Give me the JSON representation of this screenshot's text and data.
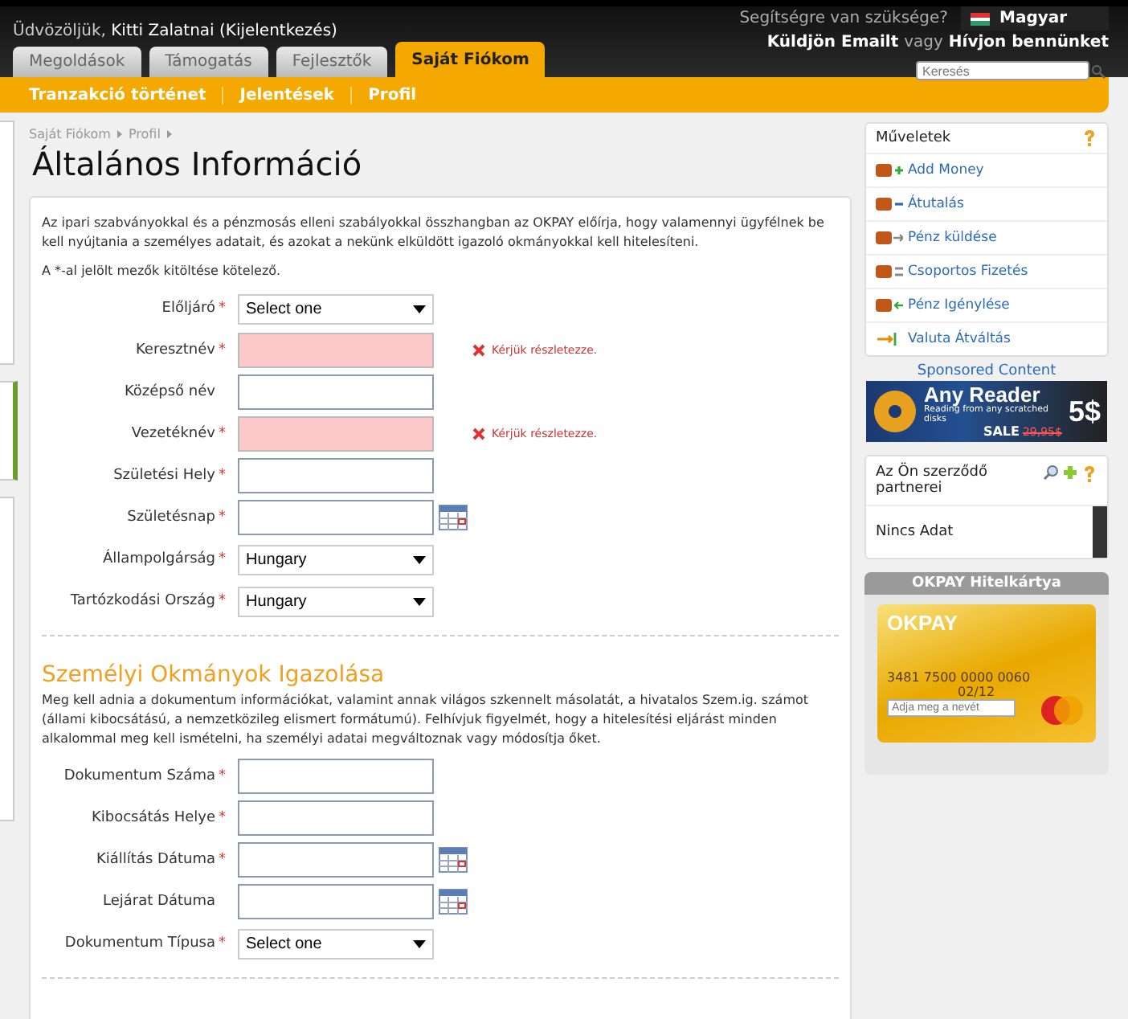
{
  "header": {
    "greeting": "Üdvözöljük,",
    "user": "Kitti Zalatnai (Kijelentkezés)",
    "help": "Segítségre van szüksége?",
    "contact_email": "Küldjön Emailt",
    "contact_or": "vagy",
    "contact_call": "Hívjon bennünket",
    "language": "Magyar",
    "search": {
      "placeholder": "Keresés"
    }
  },
  "tabs": [
    {
      "label": "Megoldások",
      "selected": false
    },
    {
      "label": "Támogatás",
      "selected": false
    },
    {
      "label": "Fejlesztők",
      "selected": false
    },
    {
      "label": "Saját Fiókom",
      "selected": true
    }
  ],
  "subnav": [
    "Tranzakció történet",
    "Jelentések",
    "Profil"
  ],
  "breadcrumb": [
    "Saját Fiókom",
    "Profil"
  ],
  "title": "Általános Információ",
  "intro": "Az ipari szabványokkal és a pénzmosás elleni szabályokkal összhangban az OKPAY előírja, hogy valamennyi ügyfélnek be kell nyújtania a személyes adatait, és azokat a nekünk elküldött igazoló okmányokkal kell hitelesíteni.",
  "required_note": "A *-al jelölt mezők kitöltése kötelező.",
  "required_mark": "*",
  "general_fields": [
    {
      "label": "Előljáró",
      "kind": "select",
      "required": true,
      "value": "Select one",
      "error": false
    },
    {
      "label": "Keresztnév",
      "kind": "text",
      "required": true,
      "error": true,
      "error_text": "Kérjük részletezze."
    },
    {
      "label": "Középső név",
      "kind": "text",
      "required": false,
      "error": false
    },
    {
      "label": "Vezetéknév",
      "kind": "text",
      "required": true,
      "error": true,
      "error_text": "Kérjük részletezze."
    },
    {
      "label": "Születési Hely",
      "kind": "text",
      "required": true,
      "error": false
    },
    {
      "label": "Születésnap",
      "kind": "date",
      "required": true,
      "error": false
    },
    {
      "label": "Állampolgárság",
      "kind": "select",
      "required": true,
      "value": "Hungary",
      "error": false
    },
    {
      "label": "Tartózkodási Ország",
      "kind": "select",
      "required": true,
      "value": "Hungary",
      "error": false
    }
  ],
  "documents": {
    "title": "Személyi Okmányok Igazolása",
    "text": "Meg kell adnia a dokumentum információkat, valamint annak világos szkennelt másolatát, a hivatalos Szem.ig. számot (állami kibocsátású, a nemzetközileg elismert formátumú). Felhívjuk figyelmét, hogy a hitelesítési eljárást minden alkalommal meg kell ismételni, ha személyi adatai megváltoznak vagy módosítja őket.",
    "fields": [
      {
        "label": "Dokumentum Száma",
        "kind": "text",
        "required": true,
        "error": false
      },
      {
        "label": "Kibocsátás Helye",
        "kind": "text",
        "required": true,
        "error": false
      },
      {
        "label": "Kiállítás Dátuma",
        "kind": "date",
        "required": true,
        "error": false
      },
      {
        "label": "Lejárat Dátuma",
        "kind": "date",
        "required": false,
        "error": false
      },
      {
        "label": "Dokumentum Típusa",
        "kind": "select",
        "required": true,
        "value": "Select one",
        "error": false
      }
    ]
  },
  "actions": {
    "title": "Műveletek",
    "items": [
      {
        "label": "Add Money",
        "kind": "plus"
      },
      {
        "label": "Átutalás",
        "kind": "minus"
      },
      {
        "label": "Pénz küldése",
        "kind": "send"
      },
      {
        "label": "Csoportos Fizetés",
        "kind": "group"
      },
      {
        "label": "Pénz Igénylése",
        "kind": "request"
      },
      {
        "label": "Valuta Átváltás",
        "kind": "exchange"
      }
    ]
  },
  "sponsored": {
    "title": "Sponsored Content",
    "ad_title": "Any Reader",
    "ad_text": "Reading from any scratched disks",
    "ad_sale": "SALE",
    "ad_old_price": "29,95$",
    "ad_price": "5$"
  },
  "partners": {
    "title": "Az Ön szerződő partnerei",
    "empty": "Nincs Adat"
  },
  "card": {
    "title": "OKPAY Hitelkártya",
    "brand": "OKPAY",
    "number": "3481 7500 0000 0060",
    "expiry": "02/12",
    "name_placeholder": "Adja meg a nevét"
  }
}
